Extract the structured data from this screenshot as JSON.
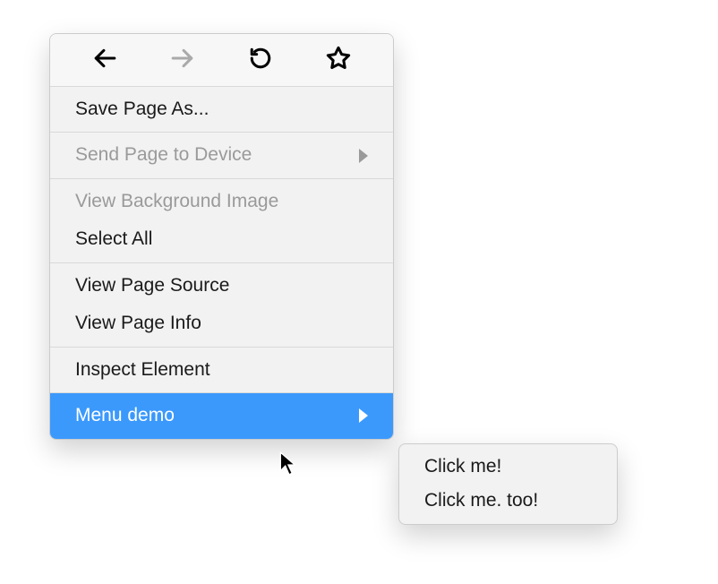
{
  "menu": {
    "save_as_label": "Save Page As...",
    "send_to_device_label": "Send Page to Device",
    "view_bg_image_label": "View Background Image",
    "select_all_label": "Select All",
    "view_source_label": "View Page Source",
    "view_info_label": "View Page Info",
    "inspect_label": "Inspect Element",
    "menu_demo_label": "Menu demo"
  },
  "submenu": {
    "item1_label": "Click me!",
    "item2_label": "Click me. too!"
  }
}
